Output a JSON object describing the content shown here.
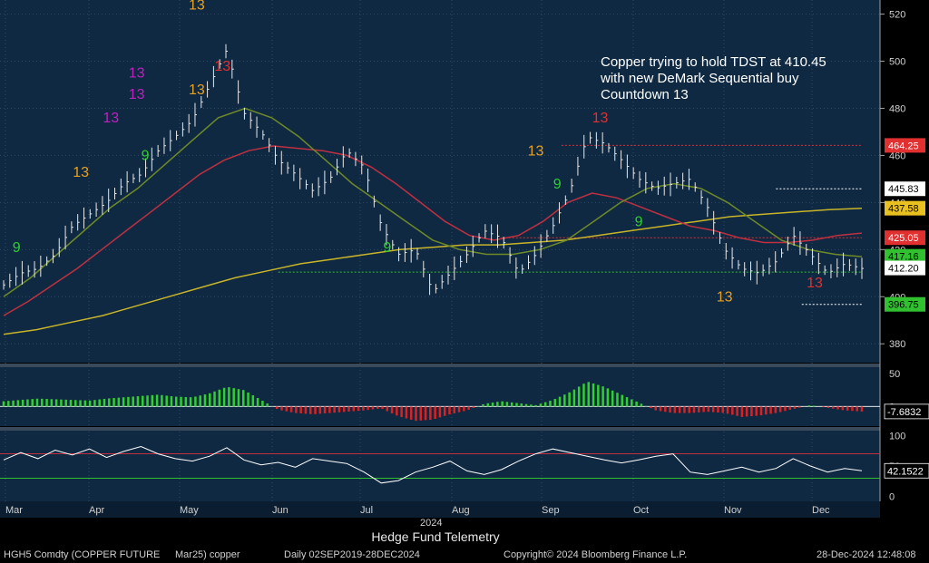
{
  "chart_data": {
    "type": "line",
    "title": "",
    "instrument": "HGH5 Comdty (COPPER FUTURE",
    "contract": "Mar25) copper",
    "frequency": "Daily 02SEP2019-28DEC2024",
    "copyright": "Copyright© 2024 Bloomberg Finance L.P.",
    "timestamp": "28-Dec-2024 12:48:08",
    "watermark": "Hedge Fund Telemetry",
    "year_label": "2024",
    "annotation": "Copper trying to hold TDST at 410.45 with new DeMark Sequential buy Countdown 13",
    "x_labels": [
      "Mar",
      "Apr",
      "May",
      "Jun",
      "Jul",
      "Aug",
      "Sep",
      "Oct",
      "Nov",
      "Dec"
    ],
    "y_ticks": [
      380,
      400,
      420,
      440,
      460,
      480,
      500,
      520
    ],
    "ylim": [
      372,
      526
    ],
    "price_labels": [
      {
        "value": 464.25,
        "text": "464.25",
        "color": "#e03030"
      },
      {
        "value": 445.83,
        "text": "445.83",
        "color": "#ffffff"
      },
      {
        "value": 437.58,
        "text": "437.58",
        "color": "#e8c020"
      },
      {
        "value": 425.05,
        "text": "425.05",
        "color": "#e03030"
      },
      {
        "value": 417.16,
        "text": "417.16",
        "color": "#30c030"
      },
      {
        "value": 412.2,
        "text": "412.20",
        "color": "#ffffff"
      },
      {
        "value": 396.75,
        "text": "396.75",
        "color": "#30c030"
      }
    ],
    "price_series": {
      "name": "copper",
      "x": [
        0,
        0.02,
        0.04,
        0.06,
        0.08,
        0.1,
        0.12,
        0.14,
        0.16,
        0.18,
        0.2,
        0.22,
        0.24,
        0.26,
        0.28,
        0.3,
        0.32,
        0.34,
        0.36,
        0.38,
        0.4,
        0.42,
        0.44,
        0.46,
        0.48,
        0.5,
        0.52,
        0.54,
        0.56,
        0.58,
        0.6,
        0.62,
        0.64,
        0.66,
        0.68,
        0.7,
        0.72,
        0.74,
        0.76,
        0.78,
        0.8,
        0.82,
        0.84,
        0.86,
        0.88,
        0.9,
        0.92,
        0.94,
        0.96,
        0.98,
        1.0
      ],
      "values": [
        405,
        410,
        412,
        418,
        430,
        435,
        440,
        448,
        452,
        462,
        468,
        475,
        490,
        505,
        478,
        470,
        458,
        452,
        445,
        450,
        462,
        455,
        430,
        418,
        420,
        402,
        410,
        418,
        428,
        425,
        410,
        418,
        430,
        445,
        468,
        465,
        458,
        450,
        446,
        448,
        450,
        438,
        420,
        412,
        410,
        415,
        426,
        418,
        410,
        414,
        412
      ]
    },
    "ma_red": [
      392,
      398,
      405,
      412,
      420,
      428,
      436,
      444,
      452,
      458,
      462,
      464,
      463,
      462,
      460,
      455,
      448,
      440,
      432,
      426,
      424,
      426,
      432,
      440,
      444,
      442,
      438,
      434,
      430,
      428,
      425,
      423,
      423,
      424,
      426,
      427
    ],
    "ma_yellow": [
      384,
      386,
      389,
      392,
      396,
      400,
      404,
      408,
      411,
      414,
      416,
      418,
      420,
      421,
      422,
      422,
      423,
      424,
      426,
      428,
      430,
      432,
      434,
      435,
      436,
      437,
      437.58
    ],
    "ma_green": [
      400,
      408,
      418,
      428,
      438,
      446,
      456,
      466,
      476,
      480,
      476,
      468,
      458,
      448,
      440,
      432,
      424,
      420,
      418,
      418,
      420,
      424,
      432,
      440,
      446,
      448,
      446,
      440,
      432,
      424,
      420,
      418,
      417
    ],
    "markers": [
      {
        "x": 0.015,
        "y": 419,
        "text": "9",
        "color": "#30d030"
      },
      {
        "x": 0.09,
        "y": 451,
        "text": "13",
        "color": "#e8a020"
      },
      {
        "x": 0.125,
        "y": 474,
        "text": "13",
        "color": "#c020c0"
      },
      {
        "x": 0.155,
        "y": 484,
        "text": "13",
        "color": "#c020c0"
      },
      {
        "x": 0.155,
        "y": 493,
        "text": "13",
        "color": "#c020c0"
      },
      {
        "x": 0.225,
        "y": 486,
        "text": "13",
        "color": "#e8a020"
      },
      {
        "x": 0.225,
        "y": 522,
        "text": "13",
        "color": "#e8a020"
      },
      {
        "x": 0.255,
        "y": 496,
        "text": "13",
        "color": "#e03030"
      },
      {
        "x": 0.165,
        "y": 458,
        "text": "9",
        "color": "#30d030"
      },
      {
        "x": 0.447,
        "y": 419,
        "text": "9",
        "color": "#30d030"
      },
      {
        "x": 0.62,
        "y": 460,
        "text": "13",
        "color": "#e8a020"
      },
      {
        "x": 0.695,
        "y": 474,
        "text": "13",
        "color": "#e03030"
      },
      {
        "x": 0.645,
        "y": 446,
        "text": "9",
        "color": "#30d030"
      },
      {
        "x": 0.74,
        "y": 430,
        "text": "9",
        "color": "#30d030"
      },
      {
        "x": 0.84,
        "y": 398,
        "text": "13",
        "color": "#e8a020"
      },
      {
        "x": 0.945,
        "y": 404,
        "text": "13",
        "color": "#e03030"
      }
    ],
    "tdst_lines": [
      {
        "y": 464.25,
        "from": 0.65,
        "to": 1.0,
        "color": "#e03030"
      },
      {
        "y": 445.83,
        "from": 0.9,
        "to": 1.0,
        "color": "#ffffff"
      },
      {
        "y": 425.05,
        "from": 0.58,
        "to": 1.0,
        "color": "#e03030"
      },
      {
        "y": 410.45,
        "from": 0.32,
        "to": 1.0,
        "color": "#30c030"
      },
      {
        "y": 396.75,
        "from": 0.93,
        "to": 1.0,
        "color": "#ffffff"
      }
    ],
    "macd": {
      "ylim": [
        -30,
        60
      ],
      "ticks": [
        0,
        50
      ],
      "last_text": "-7.6832",
      "values": [
        8,
        10,
        12,
        11,
        10,
        9,
        12,
        14,
        16,
        18,
        15,
        14,
        20,
        30,
        25,
        10,
        -5,
        -10,
        -12,
        -10,
        -8,
        -6,
        -3,
        -15,
        -22,
        -20,
        -12,
        -6,
        4,
        8,
        5,
        2,
        10,
        22,
        38,
        30,
        18,
        6,
        -6,
        -10,
        -10,
        -8,
        -10,
        -16,
        -14,
        -10,
        -4,
        2,
        -2,
        -6,
        -7.68
      ]
    },
    "rsi": {
      "ylim": [
        -8,
        108
      ],
      "ticks": [
        0,
        50,
        100
      ],
      "overbought": 70,
      "oversold": 30,
      "last_text": "42.1522",
      "values": [
        60,
        72,
        62,
        76,
        68,
        78,
        64,
        74,
        82,
        70,
        62,
        58,
        66,
        80,
        60,
        52,
        56,
        48,
        62,
        58,
        54,
        40,
        22,
        26,
        40,
        48,
        58,
        42,
        36,
        44,
        58,
        70,
        78,
        72,
        66,
        60,
        55,
        60,
        66,
        70,
        40,
        36,
        42,
        48,
        40,
        46,
        62,
        50,
        40,
        46,
        42.15
      ]
    }
  }
}
